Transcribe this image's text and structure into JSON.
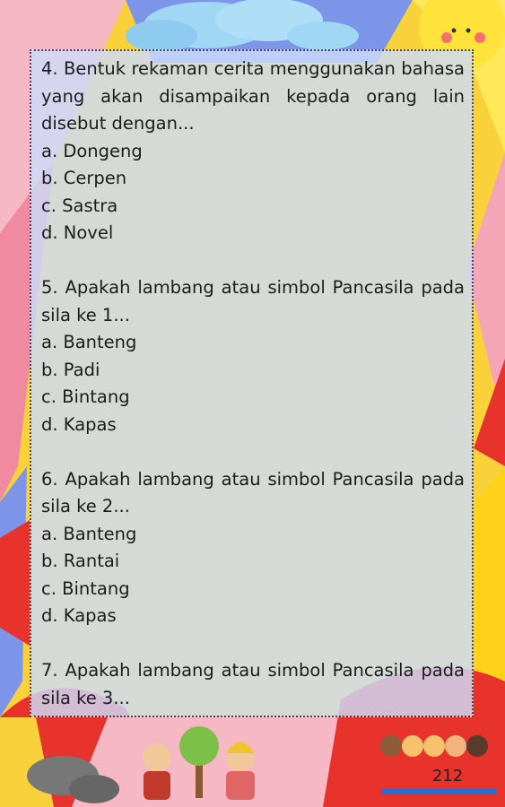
{
  "questions": [
    {
      "text": "4. Bentuk rekaman cerita menggunakan bahasa yang akan disampaikan kepada orang lain disebut dengan...",
      "options": [
        "a. Dongeng",
        "b. Cerpen",
        "c. Sastra",
        "d. Novel"
      ]
    },
    {
      "text": "5. Apakah lambang atau simbol Pancasila pada sila ke 1...",
      "options": [
        "a. Banteng",
        "b. Padi",
        "c. Bintang",
        "d. Kapas"
      ]
    },
    {
      "text": "6. Apakah lambang atau simbol Pancasila pada sila ke 2...",
      "options": [
        "a. Banteng",
        "b. Rantai",
        "c. Bintang",
        "d. Kapas"
      ]
    },
    {
      "text": "7. Apakah lambang atau simbol Pancasila pada sila ke 3...",
      "options": []
    }
  ],
  "page_number": "212",
  "colors": {
    "panel": "#cddcfa",
    "sun": "#ffe23a",
    "red": "#e8322c",
    "blue": "#7d95e8",
    "pink": "#f6b8c4",
    "yellow": "#ffd21a"
  }
}
